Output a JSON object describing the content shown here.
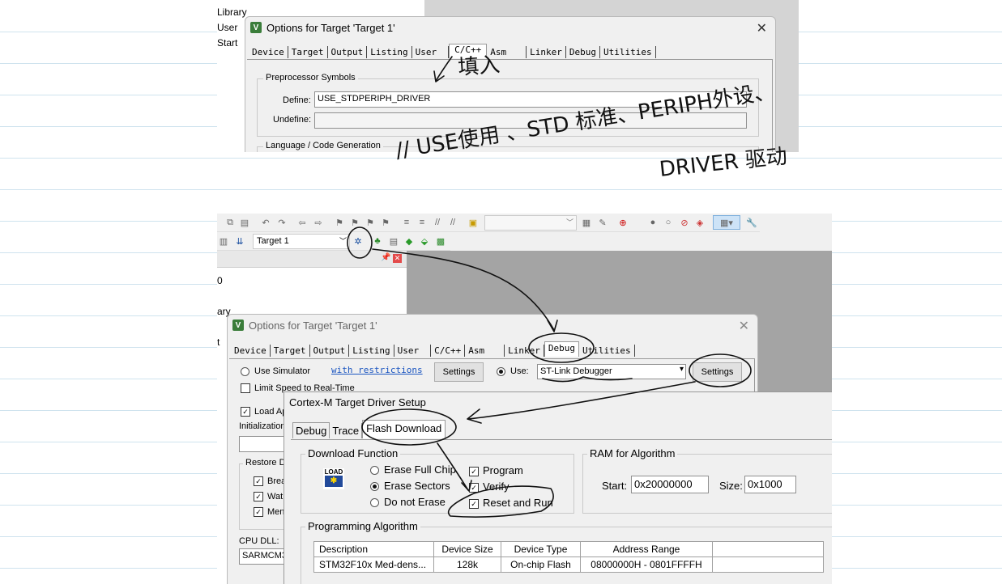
{
  "top": {
    "tree": [
      "Library",
      "User",
      "Start"
    ],
    "dialog_title": "Options for Target 'Target 1'",
    "tabs": [
      "Device",
      "Target",
      "Output",
      "Listing",
      "User",
      "C/C++",
      "Asm",
      "Linker",
      "Debug",
      "Utilities"
    ],
    "preproc_legend": "Preprocessor Symbols",
    "define_label": "Define:",
    "define_value": "USE_STDPERIPH_DRIVER",
    "undefine_label": "Undefine:",
    "lang_legend": "Language / Code Generation"
  },
  "annotations": {
    "fill_in": "填入",
    "explain_1": "// USE使用 、STD 标准、PERIPH外设、",
    "explain_2": "DRIVER 驱动"
  },
  "toolbar": {
    "target_select": "Target 1"
  },
  "left_panel": {
    "items": [
      "0",
      "ary",
      "",
      "t"
    ]
  },
  "bottom": {
    "dialog_title": "Options for Target 'Target 1'",
    "tabs": [
      "Device",
      "Target",
      "Output",
      "Listing",
      "User",
      "C/C++",
      "Asm",
      "Linker",
      "Debug",
      "Utilities"
    ],
    "use_simulator": "Use Simulator",
    "with_restrictions": "with restrictions",
    "settings_left": "Settings",
    "limit_speed": "Limit Speed to Real-Time",
    "use_label": "Use:",
    "debugger": "ST-Link Debugger",
    "settings_right": "Settings",
    "load_app": "Load Ap",
    "initialization": "Initialization",
    "restore": "Restore D",
    "restore_items": [
      "Brea",
      "Wat",
      "Men"
    ],
    "cpu_dll_label": "CPU DLL:",
    "cpu_dll_value": "SARMCM3"
  },
  "cortex": {
    "title": "Cortex-M Target Driver Setup",
    "tabs": [
      "Debug",
      "Trace",
      "Flash Download"
    ],
    "download_legend": "Download Function",
    "load_icon_text": "LOAD",
    "erase_options": [
      "Erase Full Chip",
      "Erase Sectors",
      "Do not Erase"
    ],
    "erase_selected": 1,
    "checks": [
      "Program",
      "Verify",
      "Reset and Run"
    ],
    "ram_legend": "RAM for Algorithm",
    "start_label": "Start:",
    "start_value": "0x20000000",
    "size_label": "Size:",
    "size_value": "0x1000",
    "prog_legend": "Programming Algorithm",
    "columns": [
      "Description",
      "Device Size",
      "Device Type",
      "Address Range"
    ],
    "rows": [
      [
        "STM32F10x Med-dens...",
        "128k",
        "On-chip Flash",
        "08000000H - 0801FFFFH"
      ]
    ]
  }
}
